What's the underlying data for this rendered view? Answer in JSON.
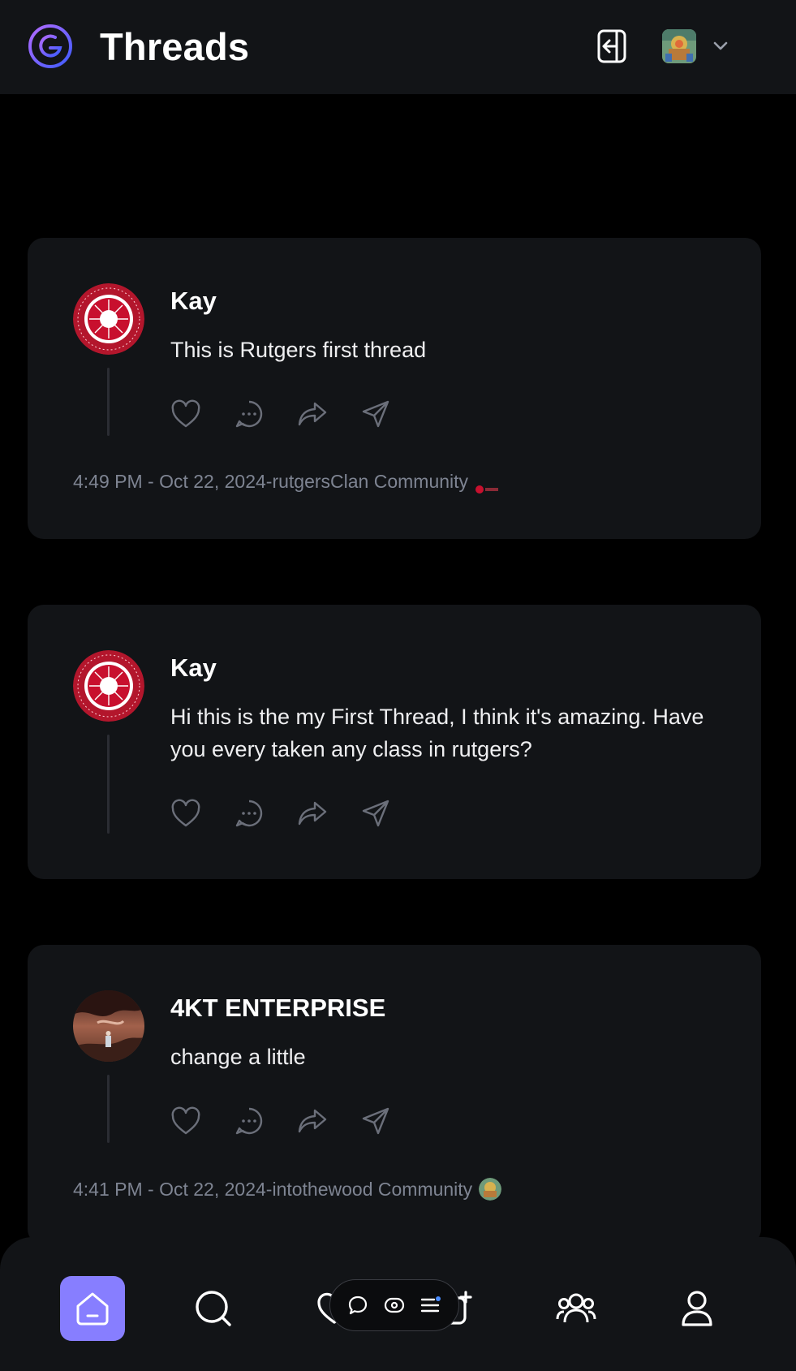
{
  "header": {
    "app_title": "Threads",
    "logo_icon": "threads-logo-icon",
    "logout_icon": "logout-icon",
    "org_switcher_icon": "chevron-down-icon"
  },
  "threads": [
    {
      "author": "Kay",
      "content": "This is Rutgers first thread",
      "meta": "4:49 PM - Oct 22, 2024-rutgersClan Community",
      "avatar": "rutgers-seal"
    },
    {
      "author": "Kay",
      "content": "Hi this is the my First Thread, I think it's amazing. Have you every taken any class in rutgers?",
      "avatar": "rutgers-seal"
    },
    {
      "author": "4KT ENTERPRISE",
      "content": "change a little",
      "meta": "4:41 PM - Oct 22, 2024-intothewood Community",
      "avatar": "canyon-photo"
    }
  ],
  "bottom_nav": {
    "items": [
      "home-icon",
      "search-icon",
      "heart-icon",
      "create-thread-icon",
      "communities-icon",
      "profile-icon"
    ],
    "active": "home-icon"
  },
  "colors": {
    "accent": "#877eff",
    "card": "#121417",
    "background": "#000000",
    "meta_text": "#7e8492"
  }
}
